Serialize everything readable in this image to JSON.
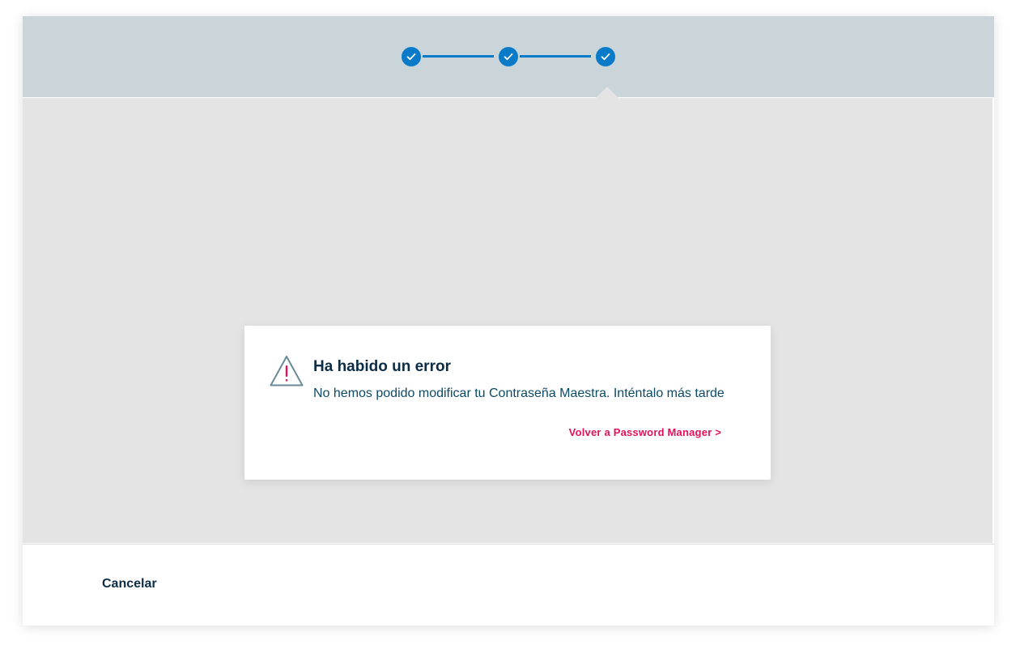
{
  "stepper": {
    "steps": [
      {
        "state": "completed",
        "icon": "check-icon"
      },
      {
        "state": "completed",
        "icon": "check-icon"
      },
      {
        "state": "completed",
        "icon": "check-icon"
      }
    ],
    "active_step": 3
  },
  "dialog": {
    "icon": "warning-icon",
    "title": "Ha habido un error",
    "message": "No hemos podido modificar tu Contraseña Maestra. Inténtalo más tarde",
    "link_label": "Volver a Password Manager >"
  },
  "footer": {
    "cancel_label": "Cancelar"
  },
  "colors": {
    "accent": "#0a7bc8",
    "link": "#e3105a",
    "stepper_bg": "#cad5da",
    "content_bg": "#e4e4e4",
    "warning_outline": "#6a8a9a",
    "warning_mark": "#e3105a"
  }
}
